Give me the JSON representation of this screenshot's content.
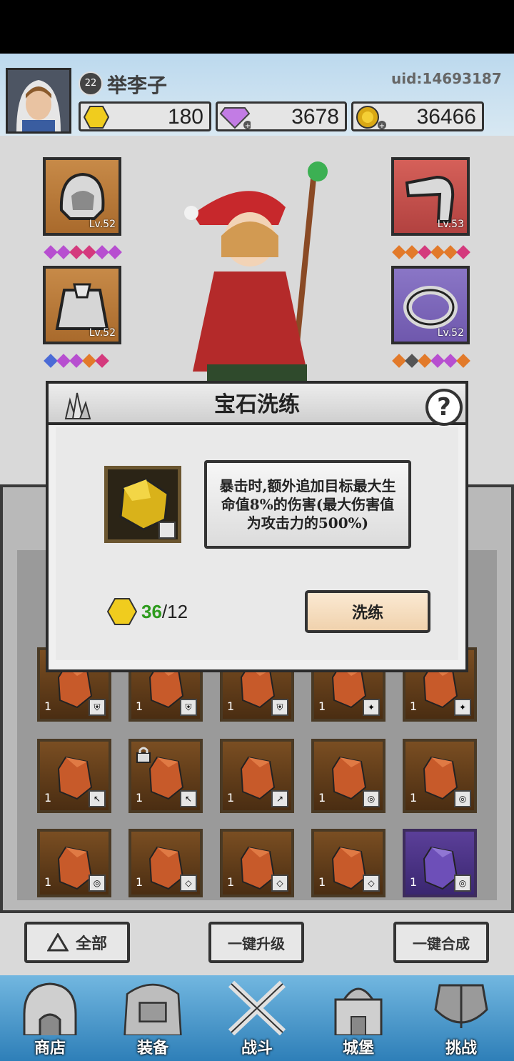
{
  "player": {
    "level": "22",
    "name": "举李子",
    "uid": "uid:14693187"
  },
  "resources": [
    {
      "name": "gold-hexagon",
      "value": "180",
      "color": "#e8c21a"
    },
    {
      "name": "purple-diamond",
      "value": "3678",
      "color": "#b36ad8"
    },
    {
      "name": "gold-coin",
      "value": "36466",
      "color": "#d4a017"
    }
  ],
  "equipment": {
    "left": [
      {
        "icon": "helmet-icon",
        "level": "Lv.52"
      },
      {
        "icon": "cape-icon",
        "level": "Lv.52"
      }
    ],
    "right": [
      {
        "icon": "arm-icon",
        "level": "Lv.53"
      },
      {
        "icon": "ring-icon",
        "level": "Lv.52"
      }
    ]
  },
  "inventory": {
    "rows": [
      [
        {
          "count": "1"
        },
        {
          "count": "1"
        },
        {
          "count": "1"
        },
        {
          "count": "1"
        },
        {
          "count": "1"
        }
      ],
      [
        {
          "count": "1"
        },
        {
          "count": "1"
        },
        {
          "count": "1"
        },
        {
          "count": "1"
        },
        {
          "count": "1"
        }
      ],
      [
        {
          "count": "1"
        },
        {
          "count": "1"
        },
        {
          "count": "1"
        },
        {
          "count": "1"
        },
        {
          "count": "1"
        }
      ]
    ]
  },
  "bottom_buttons": {
    "all": "全部",
    "upgrade": "一键升级",
    "merge": "一键合成"
  },
  "nav": [
    "商店",
    "装备",
    "战斗",
    "城堡",
    "挑战"
  ],
  "modal": {
    "title": "宝石洗练",
    "help": "?",
    "description": "暴击时,额外追加目标最大生命值8%的伤害(最大伤害值为攻击力的500%)",
    "cost_have": "36",
    "cost_sep": "/12",
    "refine_button": "洗练"
  }
}
